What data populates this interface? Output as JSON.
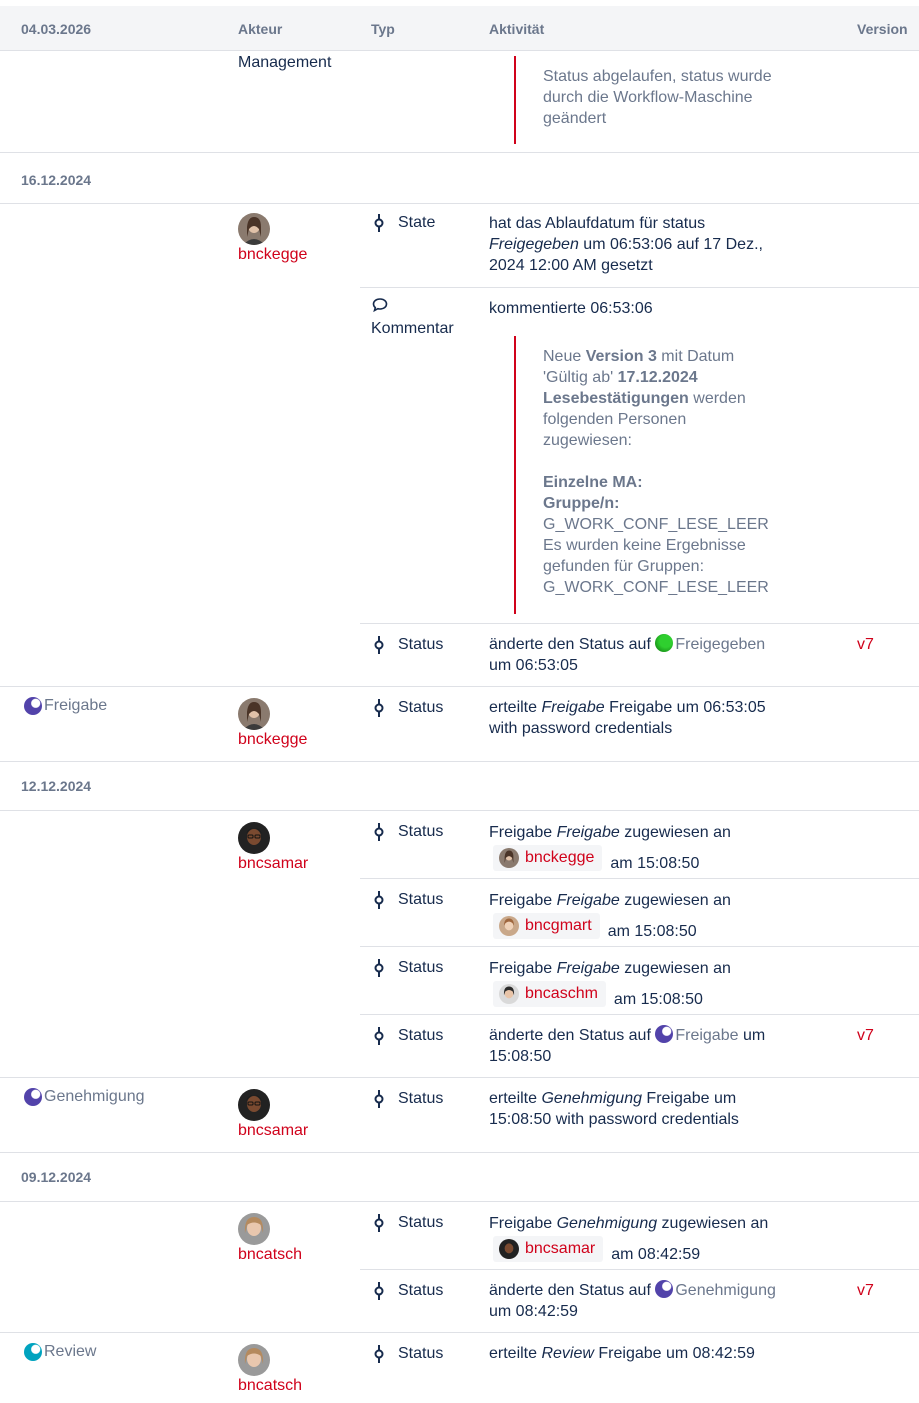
{
  "header": {
    "date": "04.03.2026",
    "actor": "Akteur",
    "type": "Typ",
    "activity": "Aktivität",
    "version": "Version"
  },
  "top": {
    "actor_tail": "Management",
    "quote_lines": [
      "Status abgelaufen, status wurde",
      "durch die Workflow-Maschine",
      "geändert"
    ]
  },
  "groups": {
    "g1": {
      "date": "16.12.2024"
    },
    "g2": {
      "date": "12.12.2024"
    },
    "g3": {
      "date": "09.12.2024"
    }
  },
  "rows": {
    "r1": {
      "user": "bnckegge",
      "type": "State",
      "l1": "hat das Ablaufdatum für status",
      "l2a": "Freigegeben",
      "l2b": " um 06:53:06 auf 17 Dez.,",
      "l3": "2024 12:00 AM gesetzt"
    },
    "r2": {
      "type_line1": "",
      "type": "Kommentar",
      "text": "kommentierte 06:53:06",
      "q1a": "Neue ",
      "q1b": "Version 3",
      "q1c": " mit Datum",
      "q2a": "'Gültig ab' ",
      "q2b": "17.12.2024",
      "q3a": "Lesebestätigungen",
      "q3b": " werden",
      "q4": "folgenden Personen",
      "q5": "zugewiesen:",
      "q6": "Einzelne MA:",
      "q7": "Gruppe/n:",
      "q8": "G_WORK_CONF_LESE_LEER",
      "q9": "Es wurden keine Ergebnisse",
      "q10": "gefunden für Gruppen:",
      "q11": "G_WORK_CONF_LESE_LEER"
    },
    "r3": {
      "type": "Status",
      "l1": "änderte den Status auf ",
      "status": "Freigegeben",
      "l2": "um 06:53:05",
      "version": "v7",
      "status_color": "#1e9e1e"
    },
    "r4": {
      "state": "Freigabe",
      "user": "bnckegge",
      "type": "Status",
      "l1a": "erteilte ",
      "l1b": "Freigabe",
      "l1c": " Freigabe um 06:53:05",
      "l2": "with password credentials"
    },
    "r5": {
      "user": "bncsamar",
      "type": "Status",
      "l1a": "Freigabe ",
      "l1b": "Freigabe",
      "l1c": " zugewiesen an",
      "chip": "bnckegge",
      "time": "am 15:08:50"
    },
    "r6": {
      "type": "Status",
      "l1a": "Freigabe ",
      "l1b": "Freigabe",
      "l1c": " zugewiesen an",
      "chip": "bncgmart",
      "time": "am 15:08:50"
    },
    "r7": {
      "type": "Status",
      "l1a": "Freigabe ",
      "l1b": "Freigabe",
      "l1c": " zugewiesen an",
      "chip": "bncaschm",
      "time": "am 15:08:50"
    },
    "r8": {
      "type": "Status",
      "l1": "änderte den Status auf ",
      "status": "Freigabe",
      "l1end": " um",
      "l2": "15:08:50",
      "version": "v7"
    },
    "r9": {
      "state": "Genehmigung",
      "user": "bncsamar",
      "type": "Status",
      "l1a": "erteilte ",
      "l1b": "Genehmigung",
      "l1c": " Freigabe um",
      "l2": "15:08:50 with password credentials"
    },
    "r10": {
      "user": "bncatsch",
      "type": "Status",
      "l1a": "Freigabe ",
      "l1b": "Genehmigung",
      "l1c": " zugewiesen an",
      "chip": "bncsamar",
      "time": "am 08:42:59"
    },
    "r11": {
      "type": "Status",
      "l1": "änderte den Status auf ",
      "status": "Genehmigung",
      "l2": "um 08:42:59",
      "version": "v7"
    },
    "r12": {
      "state": "Review",
      "user": "bncatsch",
      "type": "Status",
      "l1a": "erteilte ",
      "l1b": "Review",
      "l1c": " Freigabe um 08:42:59"
    }
  },
  "colors": {
    "link": "#d0021b",
    "muted": "#6b778c",
    "text": "#172b4d",
    "workflow_dot": "#5243aa",
    "review_dot": "#00a3bf",
    "released_dot": "#1e9e1e"
  },
  "icons": {
    "status_type": "commit-icon",
    "comment_type": "comment-icon"
  }
}
